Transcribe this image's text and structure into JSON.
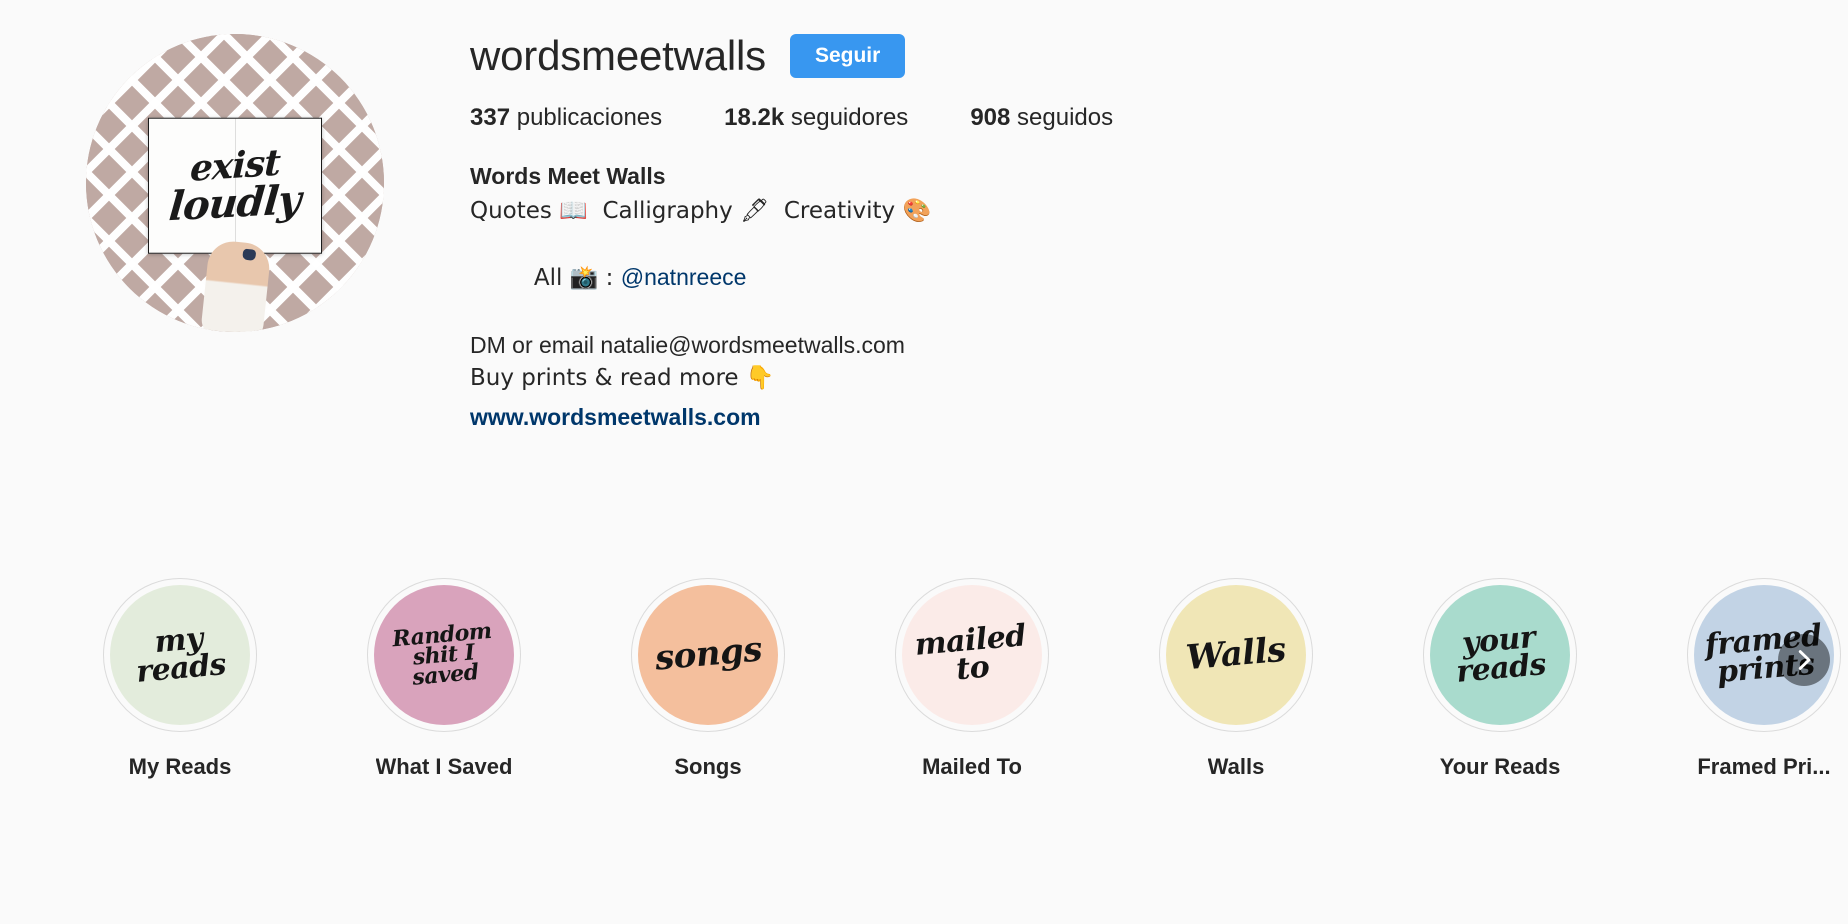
{
  "theme": {
    "background": "#fafafa",
    "text": "#262626",
    "accent_blue": "#3897f0",
    "link_blue": "#00376b",
    "border": "#dbdbdb"
  },
  "profile": {
    "username": "wordsmeetwalls",
    "follow_button_label": "Seguir",
    "avatar_alt": "exist loudly",
    "avatar_script_line1": "exist",
    "avatar_script_line2": "loudly",
    "avatar_background_color": "#bfa9a3"
  },
  "stats": [
    {
      "value": "337",
      "label": "publicaciones",
      "name": "posts"
    },
    {
      "value": "18.2k",
      "label": "seguidores",
      "name": "followers"
    },
    {
      "value": "908",
      "label": "seguidos",
      "name": "following"
    }
  ],
  "bio": {
    "display_name": "Words Meet Walls",
    "line_quotes": "Quotes 📖  Calligraphy 🖋  Creativity 🎨",
    "line_all_prefix": "All 📸 : ",
    "line_all_mention": "@natnreece",
    "line_email": "DM or email natalie@wordsmeetwalls.com",
    "line_prints": "Buy prints & read more 👇",
    "website": "www.wordsmeetwalls.com"
  },
  "highlights": [
    {
      "label": "My Reads",
      "cover_text": "my\nreads",
      "color": "#e3ecdc",
      "script_size": "hs-1"
    },
    {
      "label": "What I Saved",
      "cover_text": "Random\nshit I\nsaved",
      "color": "#d9a3bc",
      "script_size": "hs-2"
    },
    {
      "label": "Songs",
      "cover_text": "songs",
      "color": "#f4bf9d",
      "script_size": "hs-3"
    },
    {
      "label": "Mailed To",
      "cover_text": "mailed\nto",
      "color": "#fbebe8",
      "script_size": "hs-1"
    },
    {
      "label": "Walls",
      "cover_text": "Walls",
      "color": "#f0e6b6",
      "script_size": "hs-3"
    },
    {
      "label": "Your Reads",
      "cover_text": "your\nreads",
      "color": "#a9dbcd",
      "script_size": "hs-1"
    },
    {
      "label": "Framed Pri...",
      "cover_text": "framed\nprints",
      "color": "#c2d3e5",
      "script_size": "hs-1"
    }
  ],
  "controls": {
    "next_arrow_icon": "chevron-right-icon"
  }
}
